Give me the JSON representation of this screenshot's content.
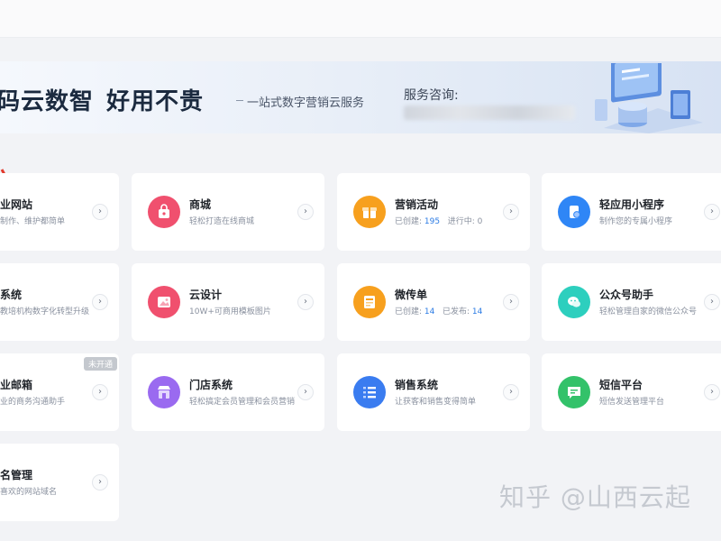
{
  "banner": {
    "brand_part1": "码云数智",
    "brand_part2": "好用不贵",
    "subtitle": "一站式数字营销云服务",
    "consult_label": "服务咨询:"
  },
  "cards": {
    "r1c0": {
      "title": "业网站",
      "desc": "制作、维护都简单",
      "icon": "website-icon"
    },
    "r1c1": {
      "title": "商城",
      "desc": "轻松打造在线商城",
      "icon": "shopping-bag-icon",
      "color": "#f0506e"
    },
    "r1c2": {
      "title": "营销活动",
      "desc_created_label": "已创建:",
      "desc_created_value": "195",
      "desc_progress_label": "进行中:",
      "desc_progress_value": "0",
      "icon": "gift-icon",
      "color": "#f7a01e"
    },
    "r1c3": {
      "title": "轻应用小程序",
      "desc": "制作您的专属小程序",
      "icon": "mini-program-icon",
      "color": "#2f86f6"
    },
    "r2c0": {
      "title": "系统",
      "desc": "教培机构数字化转型升级",
      "icon": "system-icon"
    },
    "r2c1": {
      "title": "云设计",
      "desc": "10W+可商用模板图片",
      "icon": "image-icon",
      "color": "#f0506e"
    },
    "r2c2": {
      "title": "微传单",
      "desc_created_label": "已创建:",
      "desc_created_value": "14",
      "desc_published_label": "已发布:",
      "desc_published_value": "14",
      "icon": "flyer-icon",
      "color": "#f7a01e"
    },
    "r2c3": {
      "title": "公众号助手",
      "desc": "轻松管理自家的微信公众号",
      "icon": "wechat-icon",
      "color": "#2dcfbe"
    },
    "r3c0": {
      "title": "业邮箱",
      "desc": "业的商务沟通助手",
      "badge": "未开通",
      "icon": "mailbox-icon"
    },
    "r3c1": {
      "title": "门店系统",
      "desc": "轻松搞定会员管理和会员营销",
      "icon": "store-icon",
      "color": "#9a6af0"
    },
    "r3c2": {
      "title": "销售系统",
      "desc": "让获客和销售变得简单",
      "icon": "list-icon",
      "color": "#3a7cf0"
    },
    "r3c3": {
      "title": "短信平台",
      "desc": "短信发送管理平台",
      "icon": "sms-icon",
      "color": "#33c26a"
    },
    "r4c0": {
      "title": "名管理",
      "desc": "喜欢的网站域名",
      "icon": "domain-icon"
    }
  },
  "chevron": "›",
  "watermark": "知乎 @山西云起"
}
